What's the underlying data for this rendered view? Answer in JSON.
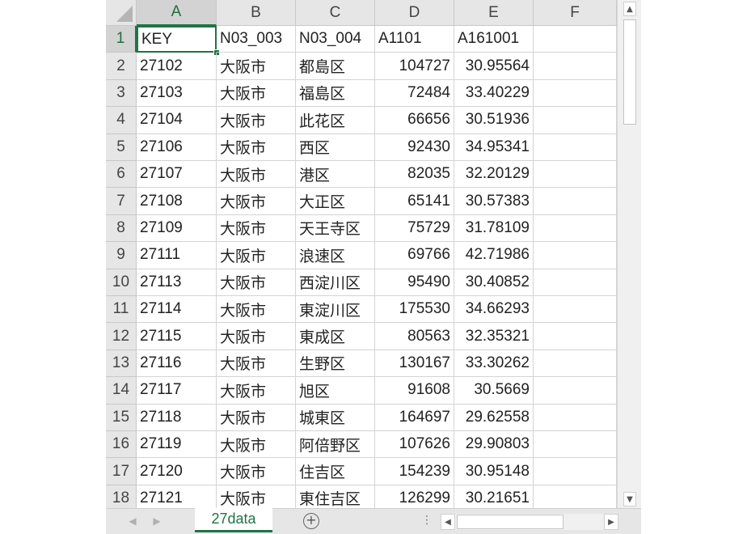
{
  "columns": [
    "A",
    "B",
    "C",
    "D",
    "E",
    "F"
  ],
  "active_cell": "A1",
  "rows": [
    {
      "num": "1",
      "cells": [
        "KEY",
        "N03_003",
        "N03_004",
        "A1101",
        "A161001",
        ""
      ]
    },
    {
      "num": "2",
      "cells": [
        "27102",
        "大阪市",
        "都島区",
        "104727",
        "30.95564",
        ""
      ]
    },
    {
      "num": "3",
      "cells": [
        "27103",
        "大阪市",
        "福島区",
        "72484",
        "33.40229",
        ""
      ]
    },
    {
      "num": "4",
      "cells": [
        "27104",
        "大阪市",
        "此花区",
        "66656",
        "30.51936",
        ""
      ]
    },
    {
      "num": "5",
      "cells": [
        "27106",
        "大阪市",
        "西区",
        "92430",
        "34.95341",
        ""
      ]
    },
    {
      "num": "6",
      "cells": [
        "27107",
        "大阪市",
        "港区",
        "82035",
        "32.20129",
        ""
      ]
    },
    {
      "num": "7",
      "cells": [
        "27108",
        "大阪市",
        "大正区",
        "65141",
        "30.57383",
        ""
      ]
    },
    {
      "num": "8",
      "cells": [
        "27109",
        "大阪市",
        "天王寺区",
        "75729",
        "31.78109",
        ""
      ]
    },
    {
      "num": "9",
      "cells": [
        "27111",
        "大阪市",
        "浪速区",
        "69766",
        "42.71986",
        ""
      ]
    },
    {
      "num": "10",
      "cells": [
        "27113",
        "大阪市",
        "西淀川区",
        "95490",
        "30.40852",
        ""
      ]
    },
    {
      "num": "11",
      "cells": [
        "27114",
        "大阪市",
        "東淀川区",
        "175530",
        "34.66293",
        ""
      ]
    },
    {
      "num": "12",
      "cells": [
        "27115",
        "大阪市",
        "東成区",
        "80563",
        "32.35321",
        ""
      ]
    },
    {
      "num": "13",
      "cells": [
        "27116",
        "大阪市",
        "生野区",
        "130167",
        "33.30262",
        ""
      ]
    },
    {
      "num": "14",
      "cells": [
        "27117",
        "大阪市",
        "旭区",
        "91608",
        "30.5669",
        ""
      ]
    },
    {
      "num": "15",
      "cells": [
        "27118",
        "大阪市",
        "城東区",
        "164697",
        "29.62558",
        ""
      ]
    },
    {
      "num": "16",
      "cells": [
        "27119",
        "大阪市",
        "阿倍野区",
        "107626",
        "29.90803",
        ""
      ]
    },
    {
      "num": "17",
      "cells": [
        "27120",
        "大阪市",
        "住吉区",
        "154239",
        "30.95148",
        ""
      ]
    },
    {
      "num": "18",
      "cells": [
        "27121",
        "大阪市",
        "東住吉区",
        "126299",
        "30.21651",
        ""
      ]
    }
  ],
  "sheet_tab": {
    "label": "27data"
  },
  "add_sheet": {
    "label": "+"
  },
  "split_handle": {
    "label": "⋮"
  },
  "icons": {
    "prev_sheet": "◀",
    "next_sheet": "▶",
    "scroll_up": "▲",
    "scroll_down": "▼",
    "scroll_left": "◀",
    "scroll_right": "▶"
  },
  "colors": {
    "accent": "#217346"
  }
}
